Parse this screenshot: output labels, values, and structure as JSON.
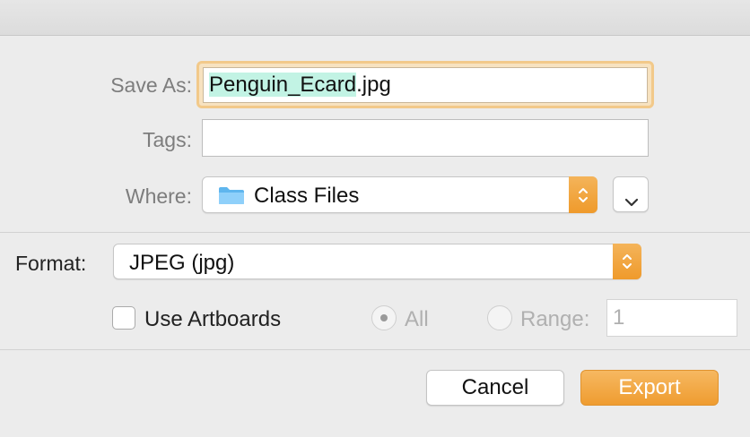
{
  "dialog": {
    "save_as": {
      "label": "Save As:",
      "name_selected": "Penguin_Ecard",
      "extension": ".jpg"
    },
    "tags": {
      "label": "Tags:",
      "value": ""
    },
    "where": {
      "label": "Where:",
      "value": "Class Files",
      "icon": "folder-icon"
    },
    "format": {
      "label": "Format:",
      "value": "JPEG (jpg)"
    },
    "artboards": {
      "label": "Use Artboards",
      "checked": false,
      "all_label": "All",
      "range_label": "Range:",
      "range_value": "1"
    },
    "buttons": {
      "cancel": "Cancel",
      "export": "Export"
    }
  },
  "colors": {
    "accent": "#ef9c30",
    "focus_ring": "#f2c98a",
    "selection": "#c2f3e4",
    "folder": "#6ec3f4"
  }
}
